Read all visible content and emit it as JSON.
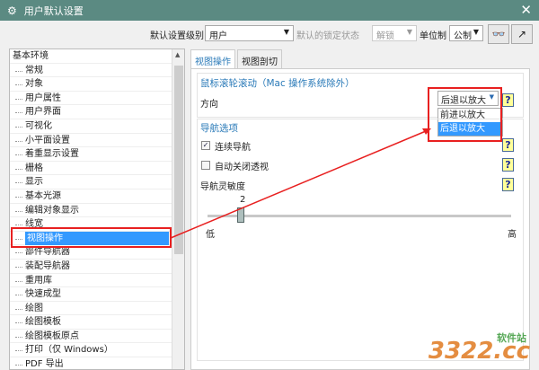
{
  "window": {
    "title": "用户默认设置",
    "close": "✕",
    "icon": "⚙"
  },
  "toolbar": {
    "level_label": "默认设置级别",
    "level_value": "用户",
    "lock_label": "默认的锁定状态",
    "lock_value": "解锁",
    "unit_label": "单位制",
    "unit_value": "公制"
  },
  "tree": {
    "items": [
      "基本环境",
      "常规",
      "对象",
      "用户属性",
      "用户界面",
      "可视化",
      "小平面设置",
      "着重显示设置",
      "栅格",
      "显示",
      "基本光源",
      "编辑对象显示",
      "线宽",
      "视图操作",
      "部件导航器",
      "装配导航器",
      "重用库",
      "快速成型",
      "绘图",
      "绘图模板",
      "绘图模板原点",
      "打印（仅 Windows）",
      "PDF 导出"
    ],
    "selected": "视图操作"
  },
  "tabs": [
    "视图操作",
    "视图剖切"
  ],
  "wheel": {
    "title": "鼠标滚轮滚动（Mac 操作系统除外）",
    "direction_label": "方向",
    "direction_value": "后退以放大",
    "options": [
      "前进以放大",
      "后退以放大"
    ],
    "highlighted": "后退以放大"
  },
  "nav": {
    "title": "导航选项",
    "continuous": {
      "label": "连续导航",
      "checked": true
    },
    "auto_close": {
      "label": "自动关闭透视",
      "checked": false
    },
    "sensitivity_label": "导航灵敏度",
    "sensitivity_value": "2",
    "sensitivity_fraction": 0.11,
    "low": "低",
    "high": "高"
  },
  "help": "?",
  "watermark": "3322.cc 软件站",
  "colors": {
    "title_bar": "#5b8a82",
    "accent": "#2a7ab8",
    "selection": "#3399ff",
    "annotation": "#e82020"
  }
}
